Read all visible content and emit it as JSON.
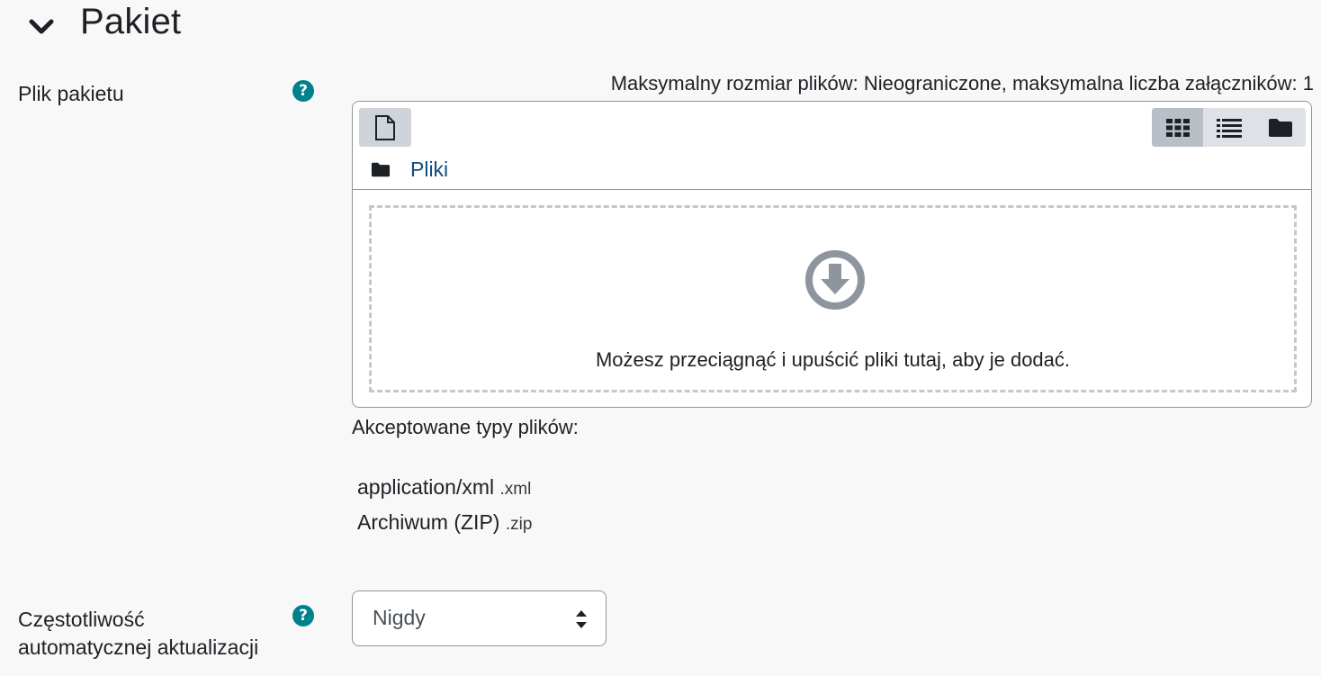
{
  "section": {
    "title": "Pakiet",
    "toggle_icon": "chevron-down-icon"
  },
  "package_file": {
    "label": "Plik pakietu",
    "help_icon": "question-circle-icon",
    "max_info": "Maksymalny rozmiar plików: Nieograniczone, maksymalna liczba załączników: 1",
    "filemanager": {
      "add_icon": "file-icon",
      "views": [
        {
          "name": "view-icons",
          "icon": "grid-icon",
          "active": true
        },
        {
          "name": "view-details",
          "icon": "list-icon",
          "active": false
        },
        {
          "name": "view-tree",
          "icon": "folder-icon",
          "active": false
        }
      ],
      "path_icon": "folder-icon",
      "path_label": "Pliki",
      "drop_icon": "download-circle-icon",
      "drop_text": "Możesz przeciągnąć i upuścić pliki tutaj, aby je dodać."
    },
    "accepted_title": "Akceptowane typy plików:",
    "accepted_types": [
      {
        "name": "application/xml",
        "ext": ".xml"
      },
      {
        "name": "Archiwum (ZIP)",
        "ext": ".zip"
      }
    ]
  },
  "update_frequency": {
    "label_line1": "Częstotliwość",
    "label_line2": "automatycznej aktualizacji",
    "help_icon": "question-circle-icon",
    "selected": "Nigdy"
  },
  "colors": {
    "help": "#00828c",
    "link": "#0f4c81",
    "background": "#f8f8f8"
  }
}
